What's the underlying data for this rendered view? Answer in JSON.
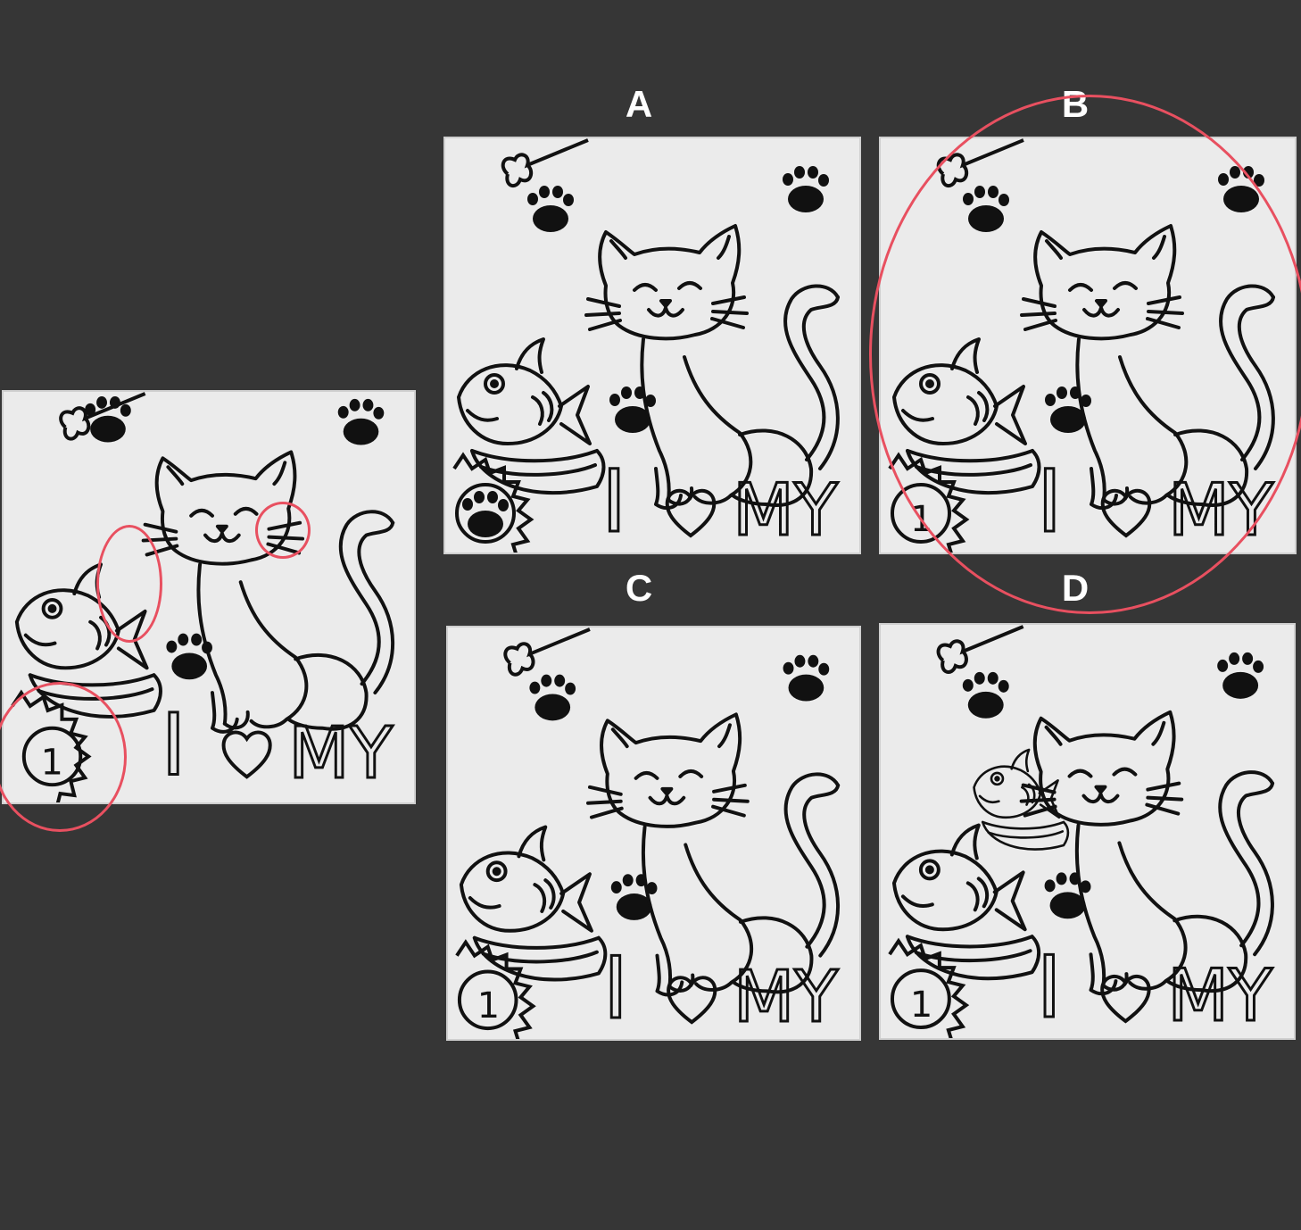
{
  "puzzle": {
    "options": [
      {
        "id": "A",
        "label": "A"
      },
      {
        "id": "B",
        "label": "B"
      },
      {
        "id": "C",
        "label": "C"
      },
      {
        "id": "D",
        "label": "D"
      }
    ],
    "selected_option": "B"
  },
  "artwork": {
    "caption_i": "I",
    "caption_my": "MY",
    "badge_number": "1"
  },
  "colors": {
    "background": "#363636",
    "panel": "#ebebeb",
    "marker": "#e85060",
    "ink": "#111111"
  }
}
